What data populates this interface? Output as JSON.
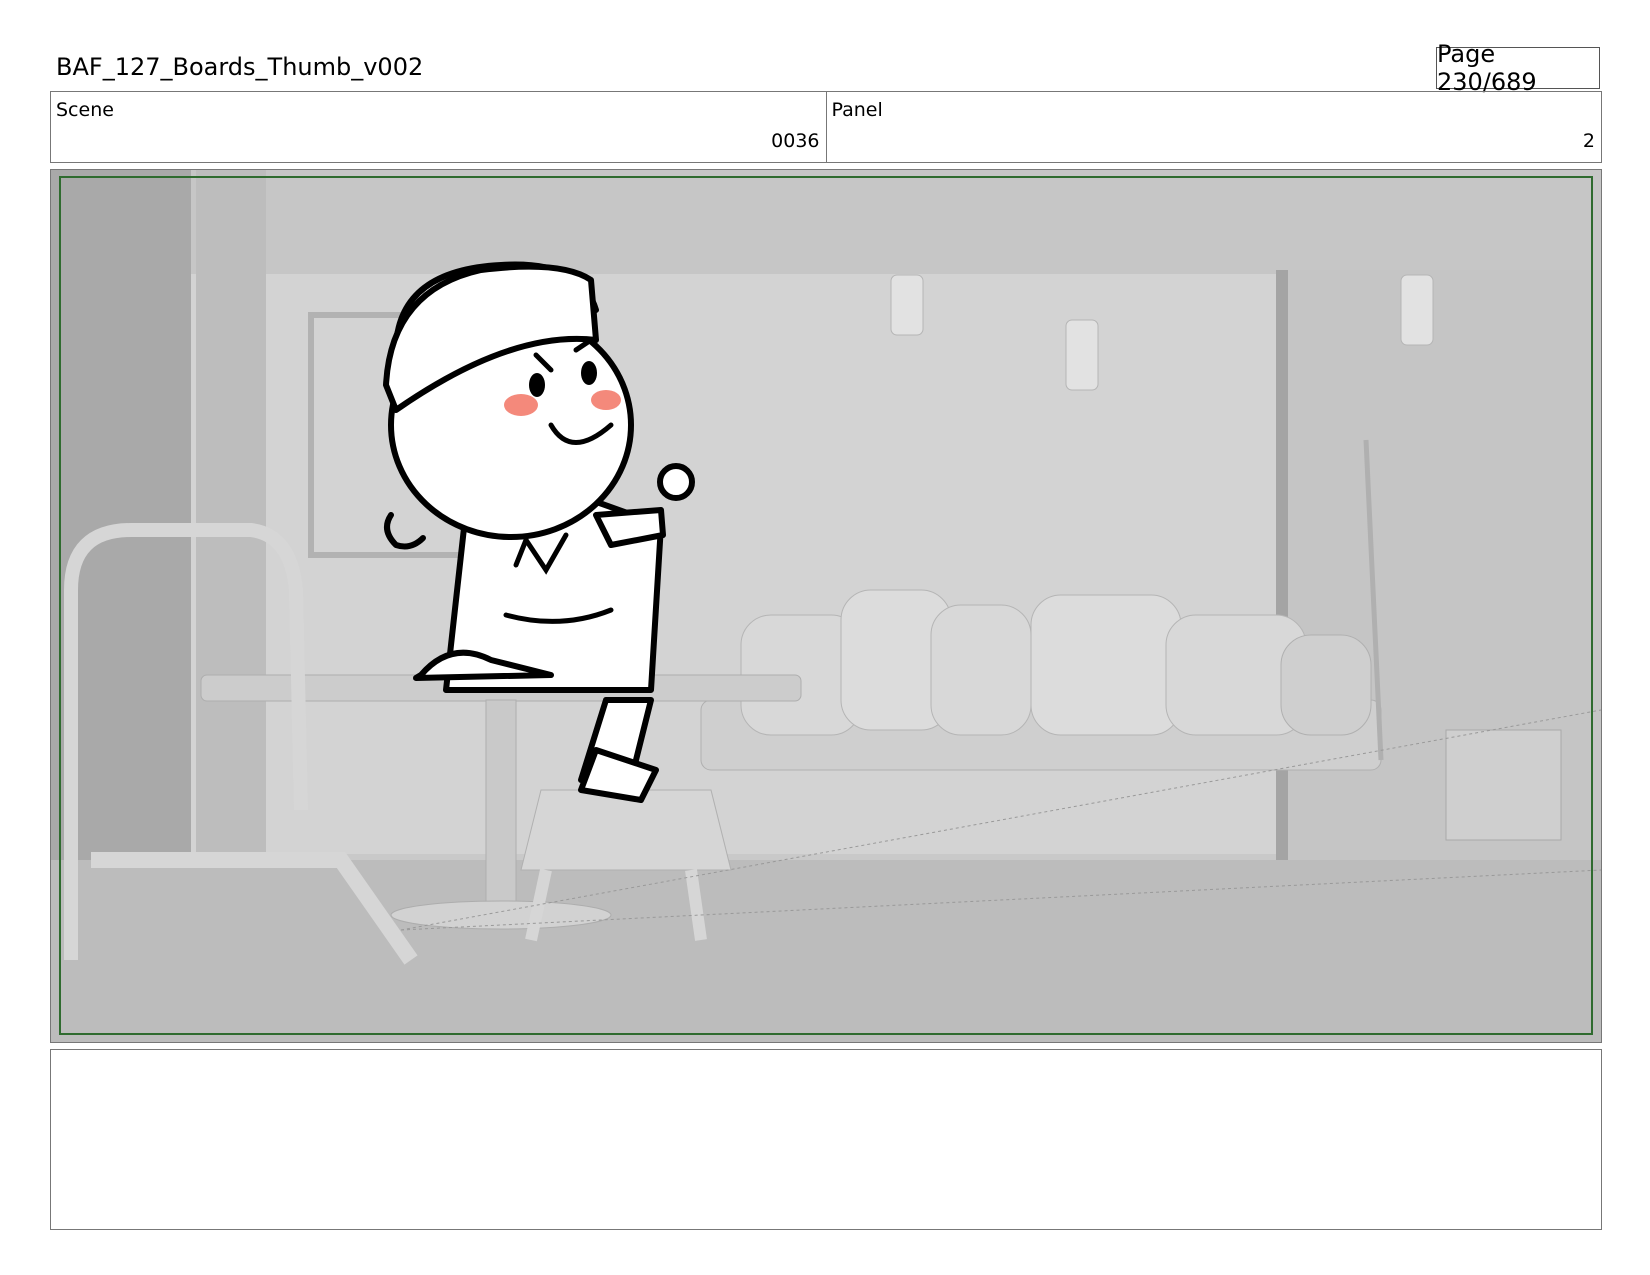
{
  "header": {
    "title": "BAF_127_Boards_Thumb_v002",
    "page": "Page 230/689"
  },
  "info": {
    "scene_label": "Scene",
    "scene_value": "0036",
    "panel_label": "Panel",
    "panel_value": "2"
  },
  "panel_image": {
    "subject": "storyboard-frame",
    "colors": {
      "safe_frame": "#2f6b2f",
      "background": "#c9c9c9",
      "cheek": "#f4897b",
      "ink": "#000000"
    }
  },
  "notes": {
    "text": ""
  }
}
